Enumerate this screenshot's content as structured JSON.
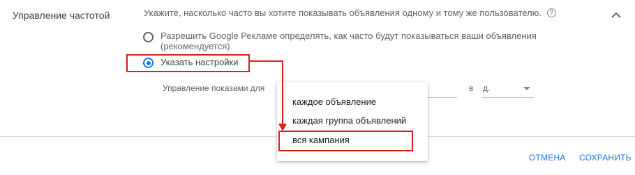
{
  "section": {
    "title": "Управление частотой",
    "description": "Укажите, насколько часто вы хотите показывать объявления одному и тому же пользователю."
  },
  "options": {
    "auto": {
      "line1": "Разрешить Google Рекламе определять, как часто будут показываться ваши объявления",
      "line2": "(рекомендуется)"
    },
    "custom": {
      "label": "Указать настройки"
    }
  },
  "settings": {
    "impressions_label": "Управление показами для",
    "in_label": "в",
    "unit_value": "д."
  },
  "dropdown": {
    "items": [
      "каждое объявление",
      "каждая группа объявлений",
      "вся кампания"
    ],
    "highlighted_index": 2
  },
  "footer": {
    "cancel_label": "ОТМЕНА",
    "save_label": "СОХРАНИТЬ"
  },
  "colors": {
    "accent": "#1a73e8",
    "annotation": "#e21b1b"
  },
  "icons": {
    "help": "question-circle-icon",
    "collapse": "chevron-up-icon",
    "select": "dropdown-arrow-icon"
  }
}
